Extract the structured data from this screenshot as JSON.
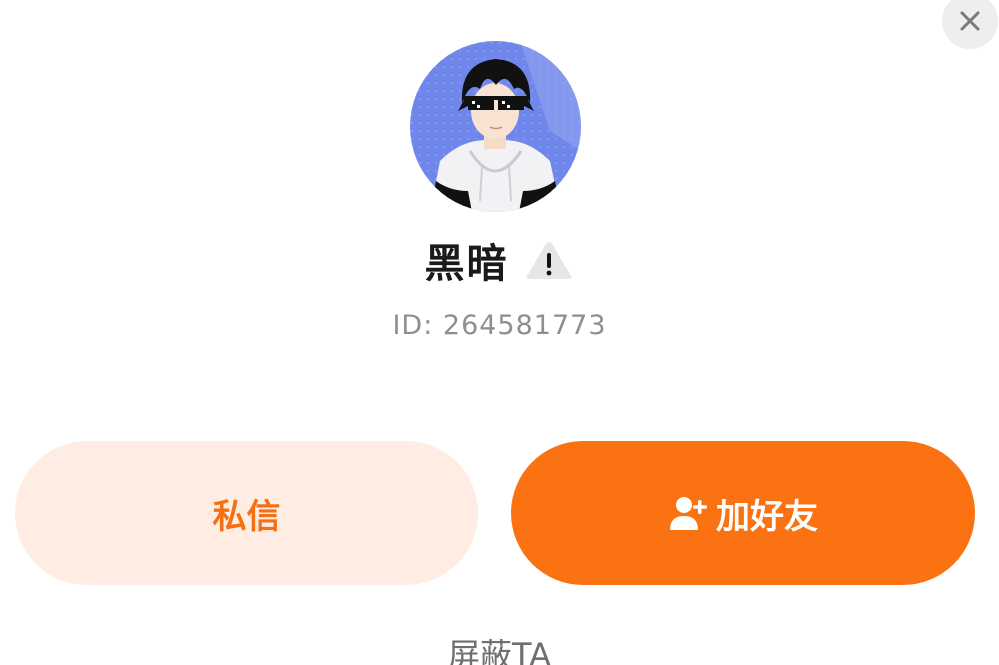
{
  "profile": {
    "name": "黑暗",
    "id_text": "ID: 264581773"
  },
  "actions": {
    "message_label": "私信",
    "add_friend_label": "加好友",
    "block_label": "屏蔽TA"
  },
  "icons": {
    "close": "close-icon",
    "warning": "warning-icon",
    "add_friend": "user-plus-icon"
  },
  "colors": {
    "accent": "#fa7212",
    "accent_light": "#ffece3",
    "secondary_text": "#8e8e93"
  }
}
